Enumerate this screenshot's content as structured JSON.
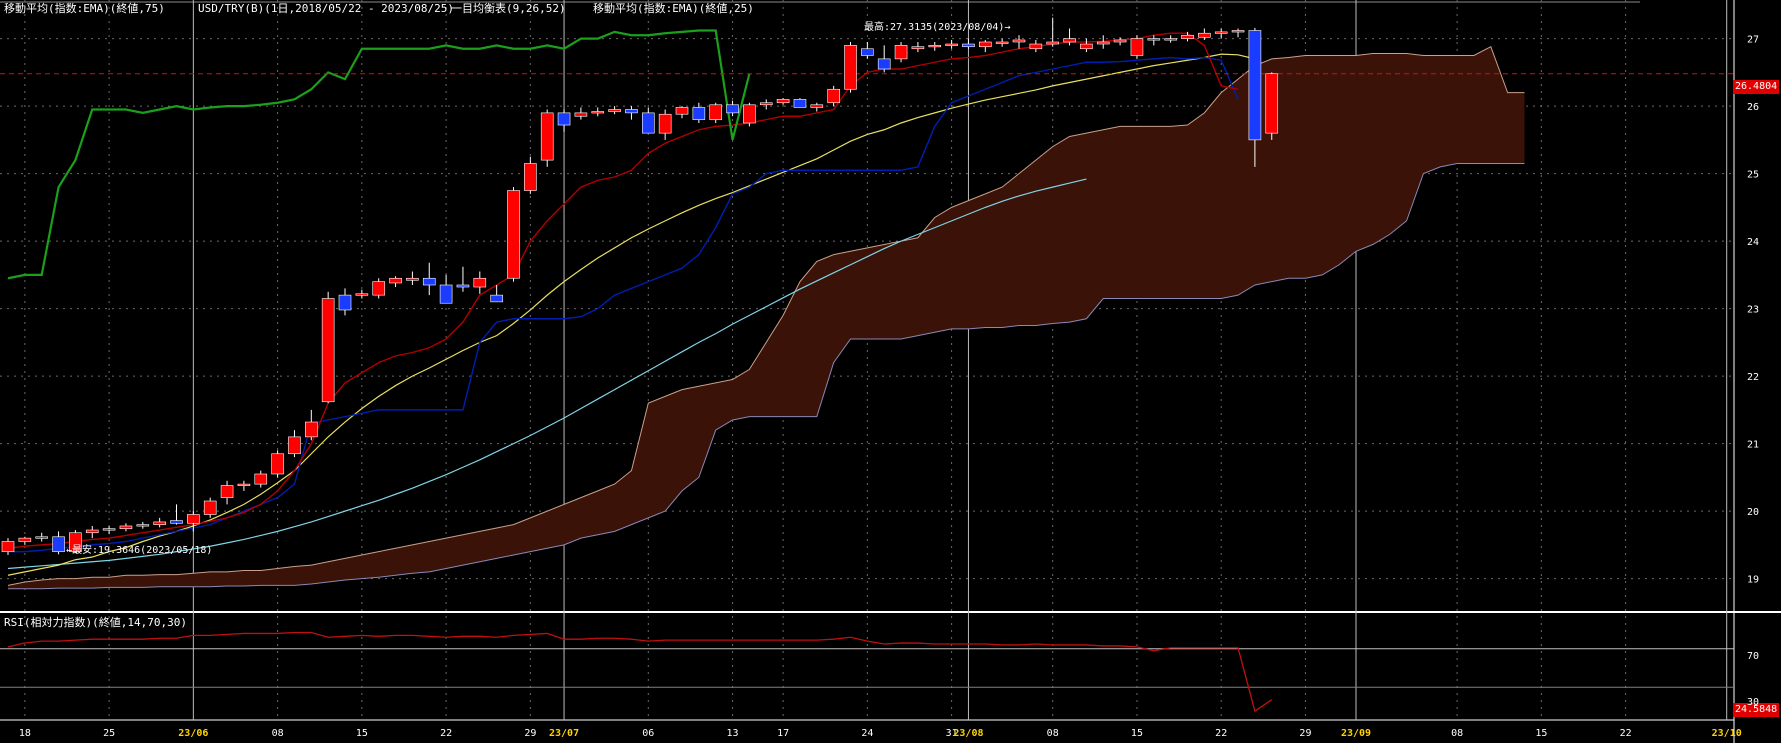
{
  "header": {
    "ema75": "移動平均(指数:EMA)(終値,75)",
    "symbol": "USD/TRY(B)(1日,2018/05/22 - 2023/08/25)",
    "ichimoku": "一目均衡表(9,26,52)",
    "ema25": "移動平均(指数:EMA)(終値,25)"
  },
  "annotations": {
    "high": "最高:27.3135(2023/08/04)→",
    "low": "←最安:19.3646(2023/05/18)",
    "last_price": "26.4804",
    "rsi_last": "24.5848"
  },
  "rsi_panel": {
    "title": "RSI(相対力指数)(終値,14,70,30)",
    "level_70": "70",
    "level_30": "30"
  },
  "colors": {
    "up": "#ff0000",
    "down": "#1a3cff",
    "ema25": "#e8e060",
    "ema75": "#7fd4e6",
    "tenkan": "#b00000",
    "kijun": "#001fb0",
    "chikou": "#1aa01a",
    "cloud": "#3a1208",
    "rsi": "#c01010"
  },
  "chart_data": {
    "type": "candlestick",
    "price_axis": {
      "ylim": [
        18.55,
        27.35
      ],
      "ticks": [
        "19",
        "20",
        "21",
        "22",
        "23",
        "24",
        "25",
        "26",
        "27"
      ]
    },
    "x_ticks": [
      {
        "label": "18",
        "month": false,
        "i": 1
      },
      {
        "label": "25",
        "month": false,
        "i": 6
      },
      {
        "label": "23/06",
        "month": true,
        "i": 11
      },
      {
        "label": "08",
        "month": false,
        "i": 16
      },
      {
        "label": "15",
        "month": false,
        "i": 21
      },
      {
        "label": "22",
        "month": false,
        "i": 26
      },
      {
        "label": "29",
        "month": false,
        "i": 31
      },
      {
        "label": "23/07",
        "month": true,
        "i": 33
      },
      {
        "label": "06",
        "month": false,
        "i": 38
      },
      {
        "label": "13",
        "month": false,
        "i": 43
      },
      {
        "label": "17",
        "month": false,
        "i": 46
      },
      {
        "label": "24",
        "month": false,
        "i": 51
      },
      {
        "label": "31",
        "month": false,
        "i": 56
      },
      {
        "label": "23/08",
        "month": true,
        "i": 57
      },
      {
        "label": "08",
        "month": false,
        "i": 62
      },
      {
        "label": "15",
        "month": false,
        "i": 67
      },
      {
        "label": "22",
        "month": false,
        "i": 72
      },
      {
        "label": "29",
        "month": false,
        "i": 77
      },
      {
        "label": "23/09",
        "month": true,
        "i": 80
      },
      {
        "label": "08",
        "month": false,
        "i": 86
      },
      {
        "label": "15",
        "month": false,
        "i": 91
      },
      {
        "label": "22",
        "month": false,
        "i": 96
      },
      {
        "label": "23/10",
        "month": true,
        "i": 102
      }
    ],
    "candles": [
      [
        19.4,
        19.6,
        19.35,
        19.55
      ],
      [
        19.55,
        19.62,
        19.5,
        19.6
      ],
      [
        19.6,
        19.68,
        19.55,
        19.62
      ],
      [
        19.62,
        19.7,
        19.36,
        19.4
      ],
      [
        19.4,
        19.72,
        19.38,
        19.68
      ],
      [
        19.68,
        19.78,
        19.6,
        19.72
      ],
      [
        19.72,
        19.78,
        19.66,
        19.74
      ],
      [
        19.74,
        19.82,
        19.7,
        19.78
      ],
      [
        19.78,
        19.84,
        19.74,
        19.8
      ],
      [
        19.8,
        19.9,
        19.76,
        19.84
      ],
      [
        19.86,
        20.1,
        19.8,
        19.82
      ],
      [
        19.82,
        20.0,
        19.7,
        19.95
      ],
      [
        19.95,
        20.2,
        19.9,
        20.15
      ],
      [
        20.2,
        20.45,
        20.1,
        20.38
      ],
      [
        20.38,
        20.45,
        20.3,
        20.4
      ],
      [
        20.4,
        20.6,
        20.35,
        20.55
      ],
      [
        20.55,
        20.9,
        20.5,
        20.85
      ],
      [
        20.85,
        21.2,
        20.8,
        21.1
      ],
      [
        21.1,
        21.5,
        21.05,
        21.32
      ],
      [
        21.62,
        23.25,
        21.6,
        23.15
      ],
      [
        23.2,
        23.3,
        22.9,
        22.98
      ],
      [
        23.2,
        23.28,
        23.15,
        23.22
      ],
      [
        23.2,
        23.45,
        23.15,
        23.4
      ],
      [
        23.38,
        23.48,
        23.32,
        23.45
      ],
      [
        23.42,
        23.55,
        23.35,
        23.45
      ],
      [
        23.45,
        23.68,
        23.2,
        23.35
      ],
      [
        23.35,
        23.5,
        23.1,
        23.08
      ],
      [
        23.35,
        23.62,
        23.25,
        23.32
      ],
      [
        23.32,
        23.55,
        23.22,
        23.45
      ],
      [
        23.2,
        23.35,
        23.1,
        23.1
      ],
      [
        23.45,
        24.8,
        23.4,
        24.75
      ],
      [
        24.75,
        25.25,
        24.7,
        25.15
      ],
      [
        25.2,
        25.95,
        25.1,
        25.9
      ],
      [
        25.9,
        25.95,
        25.62,
        25.72
      ],
      [
        25.85,
        25.98,
        25.8,
        25.9
      ],
      [
        25.9,
        25.98,
        25.85,
        25.92
      ],
      [
        25.92,
        26.0,
        25.88,
        25.95
      ],
      [
        25.95,
        26.0,
        25.8,
        25.9
      ],
      [
        25.9,
        25.98,
        25.6,
        25.6
      ],
      [
        25.6,
        25.95,
        25.5,
        25.88
      ],
      [
        25.88,
        26.0,
        25.82,
        25.98
      ],
      [
        25.98,
        26.05,
        25.75,
        25.8
      ],
      [
        25.8,
        26.05,
        25.75,
        26.02
      ],
      [
        26.02,
        26.08,
        25.85,
        25.9
      ],
      [
        25.75,
        26.05,
        25.7,
        26.02
      ],
      [
        26.02,
        26.1,
        25.95,
        26.05
      ],
      [
        26.05,
        26.12,
        26.02,
        26.1
      ],
      [
        26.1,
        26.12,
        25.98,
        25.98
      ],
      [
        25.98,
        26.05,
        25.92,
        26.02
      ],
      [
        26.05,
        26.3,
        26.0,
        26.25
      ],
      [
        26.25,
        26.95,
        26.2,
        26.9
      ],
      [
        26.85,
        26.95,
        26.7,
        26.75
      ],
      [
        26.7,
        26.9,
        26.5,
        26.55
      ],
      [
        26.7,
        26.95,
        26.65,
        26.9
      ],
      [
        26.85,
        26.95,
        26.8,
        26.88
      ],
      [
        26.88,
        26.95,
        26.82,
        26.9
      ],
      [
        26.9,
        26.98,
        26.85,
        26.92
      ],
      [
        26.92,
        27.0,
        26.85,
        26.88
      ],
      [
        26.88,
        26.98,
        26.8,
        26.95
      ],
      [
        26.95,
        27.0,
        26.88,
        26.95
      ],
      [
        26.95,
        27.05,
        26.85,
        26.98
      ],
      [
        26.85,
        26.98,
        26.8,
        26.92
      ],
      [
        26.92,
        27.31,
        26.88,
        26.95
      ],
      [
        26.95,
        27.15,
        26.9,
        27.0
      ],
      [
        26.85,
        27.0,
        26.8,
        26.92
      ],
      [
        26.92,
        27.05,
        26.85,
        26.95
      ],
      [
        26.95,
        27.02,
        26.9,
        26.98
      ],
      [
        26.75,
        27.05,
        26.7,
        27.0
      ],
      [
        27.0,
        27.05,
        26.9,
        26.98
      ],
      [
        26.98,
        27.05,
        26.94,
        27.0
      ],
      [
        27.0,
        27.1,
        26.96,
        27.05
      ],
      [
        27.02,
        27.15,
        26.98,
        27.08
      ],
      [
        27.08,
        27.15,
        27.0,
        27.1
      ],
      [
        27.1,
        27.15,
        27.02,
        27.12
      ],
      [
        27.12,
        27.16,
        25.1,
        25.5
      ],
      [
        25.6,
        26.5,
        25.5,
        26.48
      ]
    ],
    "ema25": [
      19.05,
      19.1,
      19.15,
      19.2,
      19.28,
      19.32,
      19.4,
      19.46,
      19.55,
      19.63,
      19.7,
      19.78,
      19.87,
      19.98,
      20.1,
      20.25,
      20.42,
      20.6,
      20.85,
      21.1,
      21.32,
      21.52,
      21.7,
      21.86,
      22.0,
      22.12,
      22.25,
      22.38,
      22.5,
      22.6,
      22.78,
      22.98,
      23.2,
      23.4,
      23.58,
      23.75,
      23.9,
      24.05,
      24.18,
      24.3,
      24.42,
      24.53,
      24.63,
      24.72,
      24.82,
      24.92,
      25.02,
      25.12,
      25.22,
      25.35,
      25.48,
      25.58,
      25.65,
      25.75,
      25.83,
      25.9,
      25.97,
      26.03,
      26.09,
      26.14,
      26.19,
      26.24,
      26.3,
      26.35,
      26.4,
      26.45,
      26.5,
      26.55,
      26.6,
      26.64,
      26.68,
      26.72,
      26.77,
      26.76,
      26.7
    ],
    "ema75": [
      19.15,
      19.17,
      19.19,
      19.21,
      19.23,
      19.25,
      19.27,
      19.3,
      19.33,
      19.36,
      19.4,
      19.44,
      19.48,
      19.53,
      19.58,
      19.64,
      19.7,
      19.77,
      19.84,
      19.92,
      20.0,
      20.08,
      20.16,
      20.25,
      20.34,
      20.44,
      20.54,
      20.65,
      20.76,
      20.88,
      21.0,
      21.12,
      21.25,
      21.38,
      21.52,
      21.66,
      21.8,
      21.94,
      22.08,
      22.22,
      22.36,
      22.5,
      22.63,
      22.77,
      22.9,
      23.03,
      23.16,
      23.29,
      23.41,
      23.53,
      23.65,
      23.77,
      23.89,
      24.0,
      24.1,
      24.2,
      24.3,
      24.4,
      24.5,
      24.59,
      24.67,
      24.74,
      24.8,
      24.86,
      24.92
    ],
    "tenkan": [
      19.45,
      19.48,
      19.5,
      19.52,
      19.55,
      19.58,
      19.6,
      19.64,
      19.68,
      19.72,
      19.76,
      19.8,
      19.85,
      19.9,
      19.98,
      20.1,
      20.3,
      20.6,
      21.0,
      21.6,
      21.9,
      22.05,
      22.2,
      22.3,
      22.35,
      22.42,
      22.55,
      22.8,
      23.2,
      23.35,
      23.5,
      24.0,
      24.3,
      24.55,
      24.8,
      24.9,
      24.95,
      25.05,
      25.3,
      25.45,
      25.55,
      25.65,
      25.7,
      25.72,
      25.75,
      25.8,
      25.85,
      25.85,
      25.9,
      25.95,
      26.3,
      26.5,
      26.55,
      26.55,
      26.6,
      26.65,
      26.7,
      26.72,
      26.75,
      26.8,
      26.85,
      26.88,
      26.92,
      26.95,
      26.95,
      26.96,
      26.98,
      27.0,
      27.05,
      27.08,
      27.08,
      26.9,
      26.3,
      26.25
    ],
    "kijun": [
      19.4,
      19.4,
      19.42,
      19.45,
      19.47,
      19.5,
      19.52,
      19.55,
      19.6,
      19.65,
      19.7,
      19.75,
      19.8,
      19.9,
      20.0,
      20.1,
      20.2,
      20.4,
      21.3,
      21.35,
      21.4,
      21.45,
      21.5,
      21.5,
      21.5,
      21.5,
      21.5,
      21.5,
      22.5,
      22.8,
      22.85,
      22.85,
      22.85,
      22.85,
      22.88,
      23.0,
      23.2,
      23.3,
      23.4,
      23.5,
      23.6,
      23.8,
      24.2,
      24.7,
      24.8,
      25.0,
      25.05,
      25.05,
      25.05,
      25.05,
      25.05,
      25.05,
      25.05,
      25.05,
      25.1,
      25.7,
      26.05,
      26.15,
      26.25,
      26.35,
      26.45,
      26.5,
      26.55,
      26.6,
      26.65,
      26.65,
      26.66,
      26.68,
      26.7,
      26.72,
      26.7,
      26.72,
      26.68,
      26.1
    ],
    "chikou": [
      23.45,
      23.5,
      23.5,
      24.8,
      25.2,
      25.95,
      25.95,
      25.95,
      25.9,
      25.95,
      26.0,
      25.95,
      25.98,
      26.0,
      26.0,
      26.02,
      26.05,
      26.1,
      26.25,
      26.5,
      26.4,
      26.85,
      26.85,
      26.85,
      26.85,
      26.85,
      26.9,
      26.85,
      26.85,
      26.9,
      26.85,
      26.85,
      26.9,
      26.85,
      27.0,
      27.0,
      27.1,
      27.05,
      27.05,
      27.08,
      27.1,
      27.12,
      27.12,
      25.5,
      26.48
    ],
    "span_a": [
      18.9,
      18.95,
      18.98,
      19.0,
      19.0,
      19.02,
      19.02,
      19.05,
      19.05,
      19.06,
      19.06,
      19.08,
      19.1,
      19.1,
      19.12,
      19.12,
      19.15,
      19.18,
      19.2,
      19.25,
      19.3,
      19.35,
      19.4,
      19.45,
      19.5,
      19.55,
      19.6,
      19.65,
      19.7,
      19.75,
      19.8,
      19.9,
      20.0,
      20.1,
      20.2,
      20.3,
      20.4,
      20.6,
      21.6,
      21.7,
      21.8,
      21.85,
      21.9,
      21.95,
      22.1,
      22.5,
      22.9,
      23.4,
      23.7,
      23.8,
      23.85,
      23.9,
      23.95,
      24.0,
      24.05,
      24.35,
      24.5,
      24.6,
      24.7,
      24.8,
      25.0,
      25.2,
      25.4,
      25.55,
      25.6,
      25.65,
      25.7,
      25.7,
      25.7,
      25.7,
      25.72,
      25.9,
      26.2,
      26.4,
      26.6,
      26.7,
      26.72,
      26.75,
      26.75,
      26.75,
      26.75,
      26.78,
      26.78,
      26.78,
      26.75,
      26.75,
      26.75,
      26.75,
      26.88,
      26.2,
      26.2
    ],
    "span_b": [
      18.85,
      18.85,
      18.85,
      18.86,
      18.86,
      18.86,
      18.87,
      18.87,
      18.87,
      18.88,
      18.88,
      18.88,
      18.88,
      18.89,
      18.89,
      18.9,
      18.9,
      18.9,
      18.92,
      18.95,
      18.98,
      19.0,
      19.02,
      19.05,
      19.08,
      19.1,
      19.15,
      19.2,
      19.25,
      19.3,
      19.35,
      19.4,
      19.45,
      19.5,
      19.6,
      19.65,
      19.7,
      19.8,
      19.9,
      20.0,
      20.3,
      20.5,
      21.2,
      21.35,
      21.4,
      21.4,
      21.4,
      21.4,
      21.4,
      22.2,
      22.55,
      22.55,
      22.55,
      22.55,
      22.6,
      22.65,
      22.7,
      22.7,
      22.72,
      22.72,
      22.75,
      22.75,
      22.78,
      22.8,
      22.85,
      23.15,
      23.15,
      23.15,
      23.15,
      23.15,
      23.15,
      23.15,
      23.15,
      23.2,
      23.35,
      23.4,
      23.45,
      23.45,
      23.5,
      23.65,
      23.85,
      23.95,
      24.1,
      24.3,
      25.0,
      25.1,
      25.15,
      25.15,
      25.15,
      25.15,
      25.15
    ],
    "rsi": [
      72,
      76,
      78,
      78,
      79,
      80,
      80,
      80,
      80,
      81,
      81,
      84,
      84,
      85,
      86,
      86,
      86,
      87,
      87,
      82,
      83,
      84,
      83,
      84,
      84,
      83,
      82,
      83,
      83,
      82,
      84,
      85,
      86,
      80,
      80,
      81,
      81,
      80,
      78,
      79,
      79,
      79,
      79,
      79,
      79,
      79,
      79,
      79,
      79,
      80,
      82,
      78,
      75,
      76,
      76,
      75,
      75,
      75,
      75,
      74,
      74,
      75,
      74,
      74,
      74,
      73,
      73,
      72,
      68,
      71,
      71,
      71,
      71,
      71,
      5,
      17
    ]
  }
}
